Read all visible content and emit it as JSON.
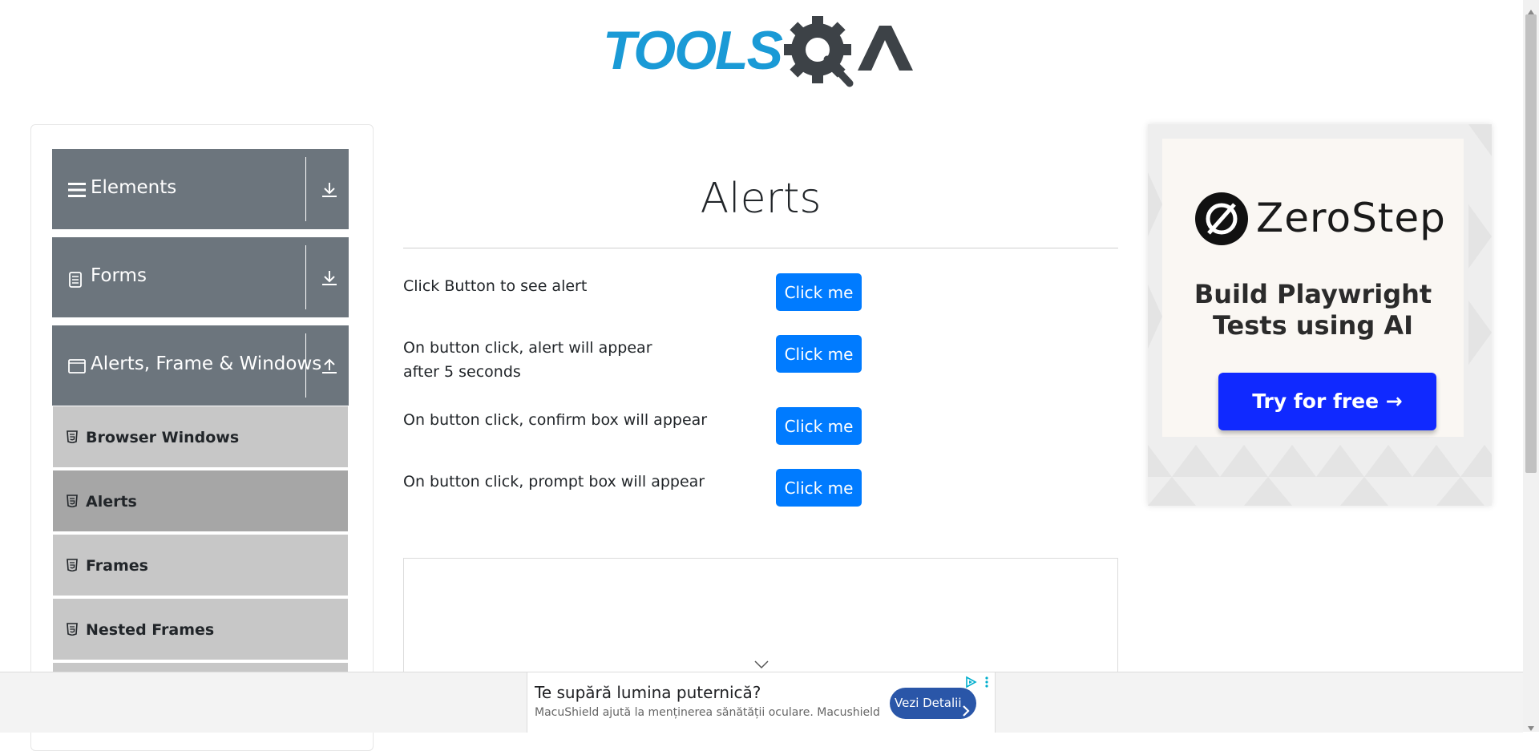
{
  "header": {
    "logo_icon": "toolsqa-logo"
  },
  "sidebar": {
    "groups": [
      {
        "label": "Elements",
        "icon": "hamburger-icon",
        "arrow_icon": "download-arrow-icon"
      },
      {
        "label": "Forms",
        "icon": "document-icon",
        "arrow_icon": "download-arrow-icon"
      },
      {
        "label": "Alerts, Frame & Windows",
        "icon": "window-icon",
        "arrow_icon": "upload-arrow-icon"
      }
    ],
    "items": [
      {
        "label": "Browser Windows",
        "icon": "html5-icon",
        "active": false
      },
      {
        "label": "Alerts",
        "icon": "html5-icon",
        "active": true
      },
      {
        "label": "Frames",
        "icon": "html5-icon",
        "active": false
      },
      {
        "label": "Nested Frames",
        "icon": "html5-icon",
        "active": false
      }
    ]
  },
  "main": {
    "title": "Alerts",
    "rows": [
      {
        "text": "Click Button to see alert",
        "button": "Click me"
      },
      {
        "text": "On button click, alert will appear after 5 seconds",
        "button": "Click me"
      },
      {
        "text": "On button click, confirm box will appear",
        "button": "Click me"
      },
      {
        "text": "On button click, prompt box will appear",
        "button": "Click me"
      }
    ]
  },
  "right_ad": {
    "brand": "ZeroStep",
    "tagline_line1": "Build Playwright",
    "tagline_line2": "Tests using AI",
    "cta": "Try for free →",
    "colors": {
      "cta": "#1029ff"
    }
  },
  "bottom_ad": {
    "headline": "Te supără lumina puternică?",
    "subtext": "MacuShield ajută la menținerea sănătății oculare. Macushield",
    "cta": "Vezi Detalii"
  },
  "colors": {
    "primary_button": "#007bff",
    "group_header": "#6c757d",
    "menu_item": "#c7c7c7",
    "menu_item_active": "#a6a6a6"
  }
}
